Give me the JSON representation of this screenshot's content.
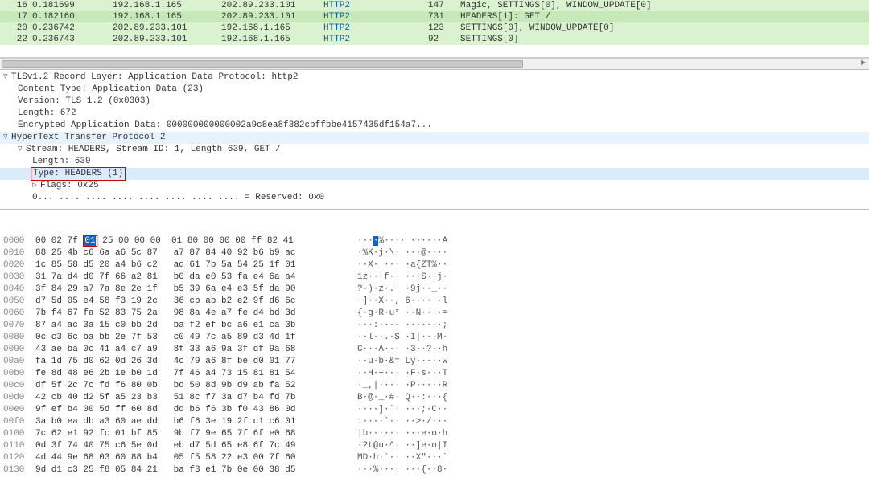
{
  "packets": [
    {
      "no": "16",
      "time": "0.181699",
      "src": "192.168.1.165",
      "dst": "202.89.233.101",
      "proto": "HTTP2",
      "len": "147",
      "info": "Magic, SETTINGS[0], WINDOW_UPDATE[0]",
      "hl": "green"
    },
    {
      "no": "17",
      "time": "0.182160",
      "src": "192.168.1.165",
      "dst": "202.89.233.101",
      "proto": "HTTP2",
      "len": "731",
      "info": "HEADERS[1]: GET /",
      "hl": "green-sel"
    },
    {
      "no": "20",
      "time": "0.236742",
      "src": "202.89.233.101",
      "dst": "192.168.1.165",
      "proto": "HTTP2",
      "len": "123",
      "info": "SETTINGS[0], WINDOW_UPDATE[0]",
      "hl": "green"
    },
    {
      "no": "22",
      "time": "0.236743",
      "src": "202.89.233.101",
      "dst": "192.168.1.165",
      "proto": "HTTP2",
      "len": "92",
      "info": "SETTINGS[0]",
      "hl": "green"
    }
  ],
  "details": {
    "tls_header": "TLSv1.2 Record Layer: Application Data Protocol: http2",
    "tls_ct": "Content Type: Application Data (23)",
    "tls_ver": "Version: TLS 1.2 (0x0303)",
    "tls_len": "Length: 672",
    "tls_enc": "Encrypted Application Data: 000000000000002a9c8ea8f382cbffbbe4157435df154a7...",
    "http2_header": "HyperText Transfer Protocol 2",
    "stream": "Stream: HEADERS, Stream ID: 1, Length 639, GET /",
    "stream_len": "Length: 639",
    "stream_type": "Type: HEADERS (1)",
    "flags": "Flags: 0x25",
    "reserved": "0... .... .... .... .... .... .... .... = Reserved: 0x0"
  },
  "hex": [
    {
      "ofs": "0000",
      "bytes_pre": "00 02 7f ",
      "byte_hi": "01",
      "bytes_post": " 25 00 00 00  01 80 00 00 00 ff 82 41",
      "ascii": "····%·········A"
    },
    {
      "ofs": "0010",
      "bytes": "88 25 4b c6 6a a6 5c 87   a7 87 84 40 92 b6 b9 ac",
      "ascii": "·%K·j·\\· ···@····"
    },
    {
      "ofs": "0020",
      "bytes": "1c 85 58 d5 20 a4 b6 c2   ad 61 7b 5a 54 25 1f 01",
      "ascii": "··X· ··· ·a{ZT%··"
    },
    {
      "ofs": "0030",
      "bytes": "31 7a d4 d0 7f 66 a2 81   b0 da e0 53 fa e4 6a a4",
      "ascii": "1z···f·· ···S··j·"
    },
    {
      "ofs": "0040",
      "bytes": "3f 84 29 a7 7a 8e 2e 1f   b5 39 6a e4 e3 5f da 90",
      "ascii": "?·)·z·.· ·9j··_··"
    },
    {
      "ofs": "0050",
      "bytes": "d7 5d 05 e4 58 f3 19 2c   36 cb ab b2 e2 9f d6 6c",
      "ascii": "·]··X··, 6······l"
    },
    {
      "ofs": "0060",
      "bytes": "7b f4 67 fa 52 83 75 2a   98 8a 4e a7 fe d4 bd 3d",
      "ascii": "{·g·R·u* ··N····="
    },
    {
      "ofs": "0070",
      "bytes": "87 a4 ac 3a 15 c0 bb 2d   ba f2 ef bc a6 e1 ca 3b",
      "ascii": "···:···- ·······;"
    },
    {
      "ofs": "0080",
      "bytes": "0c c3 6c ba bb 2e 7f 53   c0 49 7c a5 89 d3 4d 1f",
      "ascii": "··l··.·S ·I|···M·"
    },
    {
      "ofs": "0090",
      "bytes": "43 ae ba 0c 41 a4 c7 a9   8f 33 a6 9a 3f df 9a 68",
      "ascii": "C···A··· ·3··?··h"
    },
    {
      "ofs": "00a0",
      "bytes": "fa 1d 75 d0 62 0d 26 3d   4c 79 a6 8f be d0 01 77",
      "ascii": "··u·b·&= Ly·····w"
    },
    {
      "ofs": "00b0",
      "bytes": "fe 8d 48 e6 2b 1e b0 1d   7f 46 a4 73 15 81 81 54",
      "ascii": "··H·+··· ·F·s···T"
    },
    {
      "ofs": "00c0",
      "bytes": "df 5f 2c 7c fd f6 80 0b   bd 50 8d 9b d9 ab fa 52",
      "ascii": "·_,|···· ·P·····R"
    },
    {
      "ofs": "00d0",
      "bytes": "42 cb 40 d2 5f a5 23 b3   51 8c f7 3a d7 b4 fd 7b",
      "ascii": "B·@·_·#· Q··:···{"
    },
    {
      "ofs": "00e0",
      "bytes": "9f ef b4 00 5d ff 60 8d   dd b6 f6 3b f0 43 86 0d",
      "ascii": "····]·`· ···;·C··"
    },
    {
      "ofs": "00f0",
      "bytes": "3a b0 ea db a3 60 ae dd   b6 f6 3e 19 2f c1 c6 01",
      "ascii": ":····`·· ··>·/···"
    },
    {
      "ofs": "0100",
      "bytes": "7c 62 e1 92 fc 01 bf 85   9b f7 9e 65 7f 6f e0 68",
      "ascii": "|b······ ···e·o·h"
    },
    {
      "ofs": "0110",
      "bytes": "0d 3f 74 40 75 c6 5e 0d   eb d7 5d 65 e8 6f 7c 49",
      "ascii": "·?t@u·^· ··]e·o|I"
    },
    {
      "ofs": "0120",
      "bytes": "4d 44 9e 68 03 60 88 b4   05 f5 58 22 e3 00 7f 60",
      "ascii": "MD·h·`·· ··X\"···`"
    },
    {
      "ofs": "0130",
      "bytes": "9d d1 c3 25 f8 05 84 21   ba f3 e1 7b 0e 00 38 d5",
      "ascii": "···%···! ···{··8·"
    }
  ]
}
